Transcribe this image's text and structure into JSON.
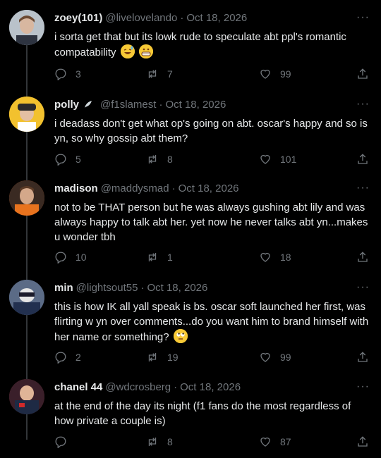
{
  "tweets": [
    {
      "name": "zoey(101)",
      "handle": "@livelovelando",
      "date": "Oct 18, 2026",
      "text": "i sorta get that but its lowk rude to speculate abt ppl's romantic compatability",
      "emojis": [
        "grinning-sweat-emoji",
        "grimacing-emoji"
      ],
      "replies": "3",
      "retweets": "7",
      "likes": "99",
      "avatar_color": "#8d9aa6"
    },
    {
      "name": "polly",
      "handle": "@f1slamest",
      "date": "Oct 18, 2026",
      "text": "i deadass don't get what op's going on abt. oscar's happy and so is yn, so why gossip abt them?",
      "replies": "5",
      "retweets": "8",
      "likes": "101",
      "avatar_color": "#f2c12e"
    },
    {
      "name": "madison",
      "handle": "@maddysmad",
      "date": "Oct 18, 2026",
      "text": "not to be THAT person but he was always gushing abt lily and was always happy to talk abt her. yet now he never talks abt yn...makes u wonder tbh",
      "replies": "10",
      "retweets": "1",
      "likes": "18",
      "avatar_color": "#c85a1e"
    },
    {
      "name": "min",
      "handle": "@lightsout55",
      "date": "Oct 18, 2026",
      "text": "this is how IK all yall speak is bs. oscar soft launched her first, was flirting w yn over comments...do you want him to brand himself with her name or something?",
      "emojis": [
        "eye-roll-emoji"
      ],
      "replies": "2",
      "retweets": "19",
      "likes": "99",
      "avatar_color": "#4a5a78"
    },
    {
      "name": "chanel 44",
      "handle": "@wdcrosberg",
      "date": "Oct 18, 2026",
      "text": "at the end of the day its night (f1 fans do the most regardless of how private a couple is)",
      "replies": "",
      "retweets": "8",
      "likes": "87",
      "avatar_color": "#7a2a2a"
    }
  ],
  "ui": {
    "more": "···",
    "sep": "·"
  }
}
